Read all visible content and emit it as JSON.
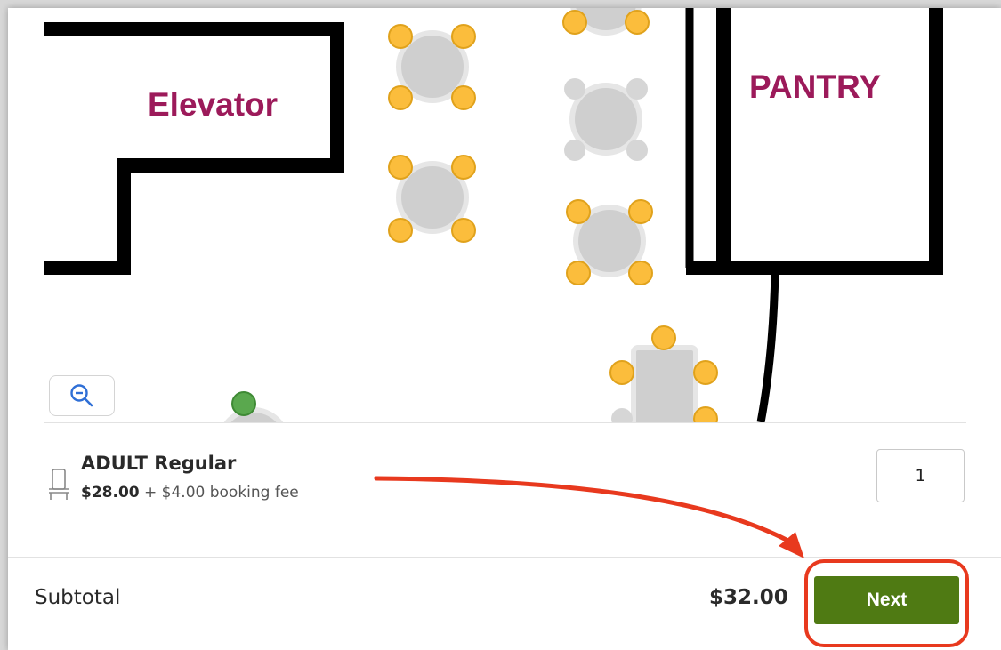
{
  "map": {
    "labels": {
      "elevator": "Elevator",
      "pantry": "PANTRY"
    },
    "zoom_out_icon": "zoom-out-icon",
    "colors": {
      "wall": "#000000",
      "label": "#9c1a5a",
      "table": "#cfcfcf",
      "seat_available": "#fbbd3c",
      "seat_unavailable": "#d6d6d6",
      "seat_selected": "#5aa84e"
    }
  },
  "ticket": {
    "name": "ADULT Regular",
    "price": "$28.00",
    "fee": "+ $4.00 booking fee",
    "quantity": "1",
    "icon": "chair-icon"
  },
  "footer": {
    "subtotal_label": "Subtotal",
    "subtotal_value": "$32.00",
    "next_label": "Next"
  },
  "annotation": {
    "arrow_color": "#e8391e",
    "highlight_color": "#e8391e"
  }
}
